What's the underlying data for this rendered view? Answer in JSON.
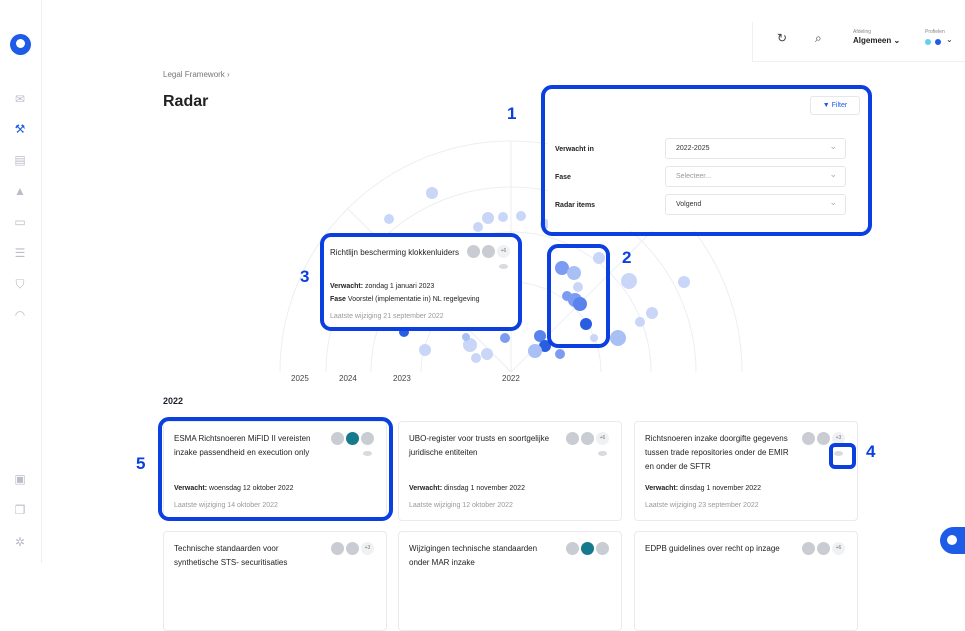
{
  "header": {
    "afdeling_label": "Afdeling",
    "afdeling_value": "Algemeen ⌄",
    "profielen_label": "Profielen",
    "profile_colors": [
      "#5fd0f0",
      "#1e5be6"
    ],
    "chevron": "⌄"
  },
  "breadcrumb": "Legal Framework  ›",
  "page_title": "Radar",
  "filter": {
    "button_label": "▼ Filter",
    "rows": [
      {
        "label": "Verwacht in",
        "value": "2022-2025",
        "placeholder": false
      },
      {
        "label": "Fase",
        "value": "Selecteer...",
        "placeholder": true
      },
      {
        "label": "Radar items",
        "value": "Volgend",
        "placeholder": false
      }
    ]
  },
  "radar": {
    "axis_labels": [
      "2025",
      "2024",
      "2023",
      "2022"
    ]
  },
  "tooltip": {
    "title": "Richtlijn bescherming klokkenluiders",
    "count": "+6",
    "expected_label": "Verwacht:",
    "expected_value": " zondag 1 januari 2023",
    "phase_label": "Fase",
    "phase_value": " Voorstel (implementatie in) NL regelgeving",
    "last_change": "Laatste wijziging 21 september 2022"
  },
  "section_title": "2022",
  "cards": [
    {
      "title": "ESMA Richtsnoeren MiFID II vereisten inzake passendheid en execution only",
      "count": "",
      "teal": true,
      "expected": " woensdag 12 oktober 2022",
      "last": "Laatste wijziging 14 oktober 2022"
    },
    {
      "title": "UBO-register voor trusts en soortgelijke juridische entiteiten",
      "count": "+6",
      "teal": false,
      "expected": " dinsdag 1 november 2022",
      "last": "Laatste wijziging 12 oktober 2022"
    },
    {
      "title": "Richtsnoeren inzake doorgifte gegevens tussen trade repositories onder de EMIR en onder de SFTR",
      "count": "+3",
      "teal": false,
      "expected": " dinsdag 1 november 2022",
      "last": "Laatste wijziging 23 september 2022"
    },
    {
      "title": "Technische standaarden voor synthetische STS- securitisaties",
      "count": "+3",
      "teal": false,
      "expected": "",
      "last": ""
    },
    {
      "title": "Wijzigingen technische standaarden onder MAR inzake",
      "count": "",
      "teal": true,
      "expected": "",
      "last": ""
    },
    {
      "title": "EDPB guidelines over recht op inzage",
      "count": "+6",
      "teal": false,
      "expected": "",
      "last": ""
    }
  ],
  "expected_label": "Verwacht:",
  "annotations": [
    "1",
    "2",
    "3",
    "4",
    "5"
  ],
  "colors": {
    "accent": "#1e5be6",
    "annotation": "#0b3fe0",
    "teal": "#177a8c"
  }
}
